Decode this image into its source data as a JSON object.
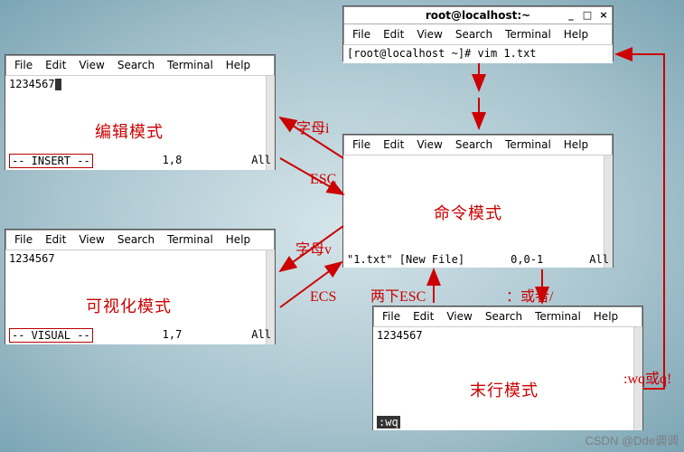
{
  "menu": {
    "file": "File",
    "edit": "Edit",
    "view": "View",
    "search": "Search",
    "terminal": "Terminal",
    "help": "Help"
  },
  "top_window": {
    "title": "root@localhost:~",
    "prompt": "[root@localhost ~]# vim 1.txt",
    "min": "_",
    "max": "□",
    "close": "×"
  },
  "edit_window": {
    "content": "1234567",
    "mode_text": "-- INSERT --",
    "pos": "1,8",
    "extent": "All",
    "label": "编辑模式"
  },
  "visual_window": {
    "content": "1234567",
    "mode_text": "-- VISUAL --",
    "pos": "1,7",
    "extent": "All",
    "label": "可视化模式"
  },
  "command_window": {
    "status_file": "\"1.txt\" [New File]",
    "pos": "0,0-1",
    "extent": "All",
    "label": "命令模式"
  },
  "lastline_window": {
    "content": "1234567",
    "cmd": ":wq",
    "label": "末行模式"
  },
  "arrows": {
    "letter_i": "字母i",
    "esc": "ESC",
    "letter_v": "字母v",
    "ecs": "ECS",
    "two_esc": "两下ESC",
    "colon_or_slash": "：或者/",
    "wq_or_q": ":wq或q!"
  },
  "watermark": "CSDN @Dde调调"
}
